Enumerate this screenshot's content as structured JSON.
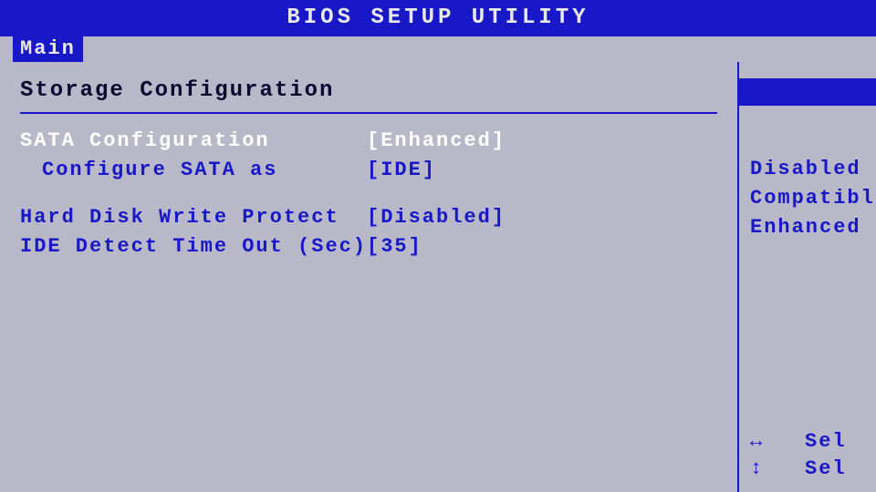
{
  "title": "BIOS SETUP UTILITY",
  "tab": "Main",
  "section": "Storage Configuration",
  "rows": {
    "sata_conf": {
      "label": "SATA Configuration",
      "value": "[Enhanced]"
    },
    "conf_as": {
      "label": "Configure SATA as",
      "value": "[IDE]"
    },
    "hd_wp": {
      "label": "Hard Disk Write Protect",
      "value": "[Disabled]"
    },
    "ide_to": {
      "label": "IDE Detect Time Out (Sec)",
      "value": "[35]"
    }
  },
  "help": {
    "options": [
      "Disabled",
      "Compatible",
      "Enhanced"
    ]
  },
  "legend": {
    "lr": "Sel",
    "ud": "Sel"
  }
}
